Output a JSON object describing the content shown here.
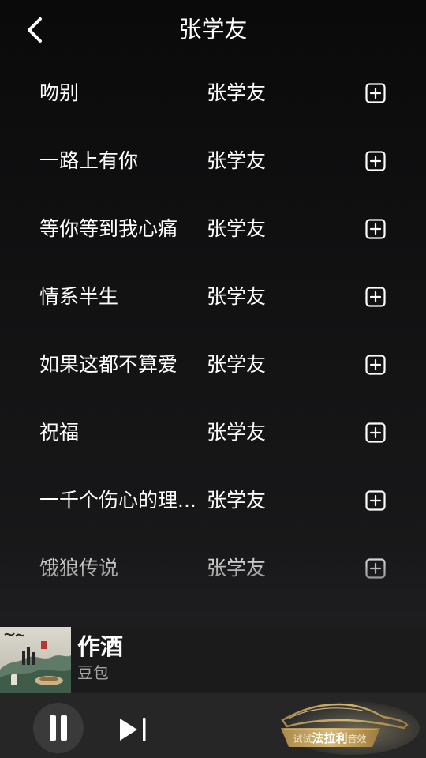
{
  "header": {
    "title": "张学友"
  },
  "songs": [
    {
      "title": "吻别",
      "artist": "张学友"
    },
    {
      "title": "一路上有你",
      "artist": "张学友"
    },
    {
      "title": "等你等到我心痛",
      "artist": "张学友"
    },
    {
      "title": "情系半生",
      "artist": "张学友"
    },
    {
      "title": "如果这都不算爱",
      "artist": "张学友"
    },
    {
      "title": "祝福",
      "artist": "张学友"
    },
    {
      "title": "一千个伤心的理...",
      "artist": "张学友"
    },
    {
      "title": "饿狼传说",
      "artist": "张学友"
    }
  ],
  "now_playing": {
    "title": "作酒",
    "artist": "豆包"
  },
  "player": {
    "state": "playing"
  },
  "promo": {
    "prefix": "试试",
    "main": "法拉利",
    "suffix": "音效"
  },
  "colors": {
    "background": "#121213",
    "player_bar": "#262627",
    "promo_gold": "#c9a660",
    "secondary_text": "#a4a4a4"
  },
  "icons": [
    "back-arrow-icon",
    "add-to-playlist-icon",
    "pause-icon",
    "skip-next-icon",
    "car-icon"
  ]
}
